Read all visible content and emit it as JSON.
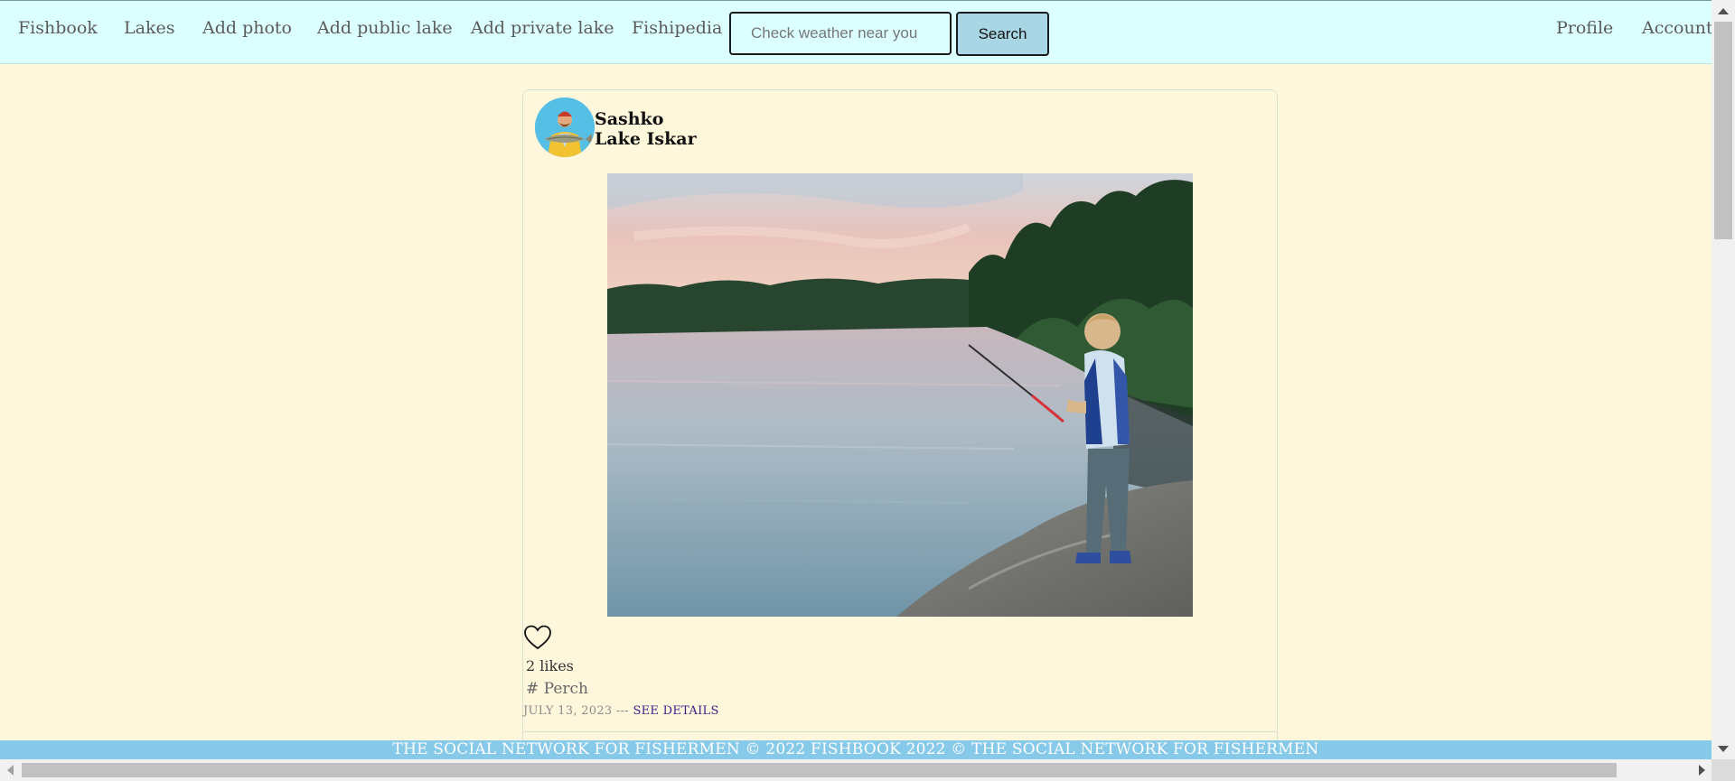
{
  "nav": {
    "brand": "Fishbook",
    "lakes": "Lakes",
    "add_photo": "Add photo",
    "add_public_lake": "Add public lake",
    "add_private_lake": "Add private lake",
    "fishipedia": "Fishipedia",
    "profile": "Profile",
    "account": "Account"
  },
  "search": {
    "placeholder": "Check weather near you",
    "value": "",
    "button_label": "Search"
  },
  "post": {
    "avatar_icon": "fisherman-avatar",
    "user": "Sashko",
    "lake": "Lake Iskar",
    "photo_icon": "kid-fishing-lake-photo",
    "like_icon": "heart-outline-icon",
    "likes": "2 likes",
    "tag": "# Perch",
    "date": "JULY 13, 2023",
    "separator": "---",
    "see_details": "SEE DETAILS"
  },
  "footer": {
    "text": "THE SOCIAL NETWORK FOR FISHERMEN © 2022 FISHBOOK 2022 © THE SOCIAL NETWORK FOR FISHERMEN"
  },
  "colors": {
    "page_bg": "#fff7dc",
    "navbar_bg": "#dcffff",
    "search_button_bg": "#a9d6e5",
    "footer_bg": "#87c9e8",
    "link_purple": "#3a1e8a"
  }
}
